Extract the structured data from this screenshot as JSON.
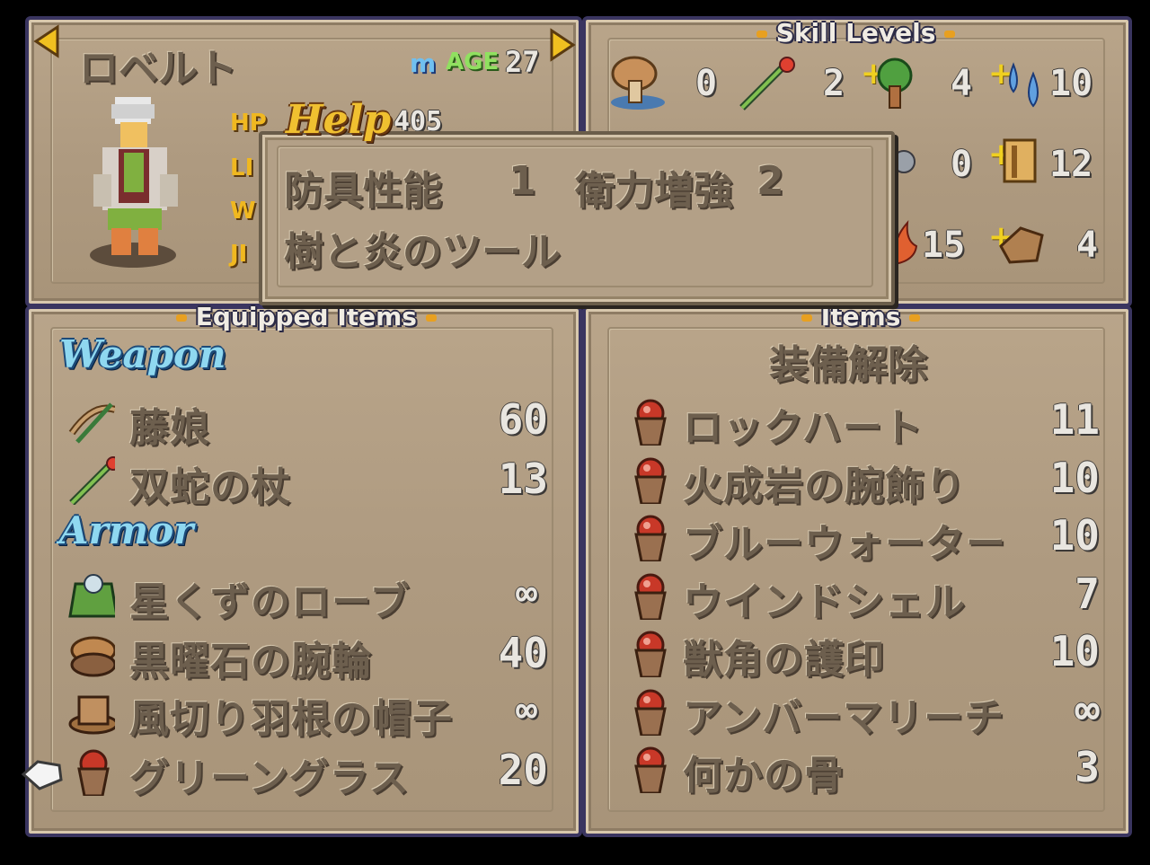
{
  "character": {
    "name": "ロベルト",
    "age_label": "AGE",
    "age": "27",
    "stats": {
      "hp_label": "HP",
      "hp_value": "405",
      "l_label": "LI",
      "w_label": "W",
      "j_label": "JI"
    }
  },
  "help_tooltip": {
    "title": "Help",
    "line1_left": "防具性能",
    "line1_left_value": "1",
    "line1_right": "衛力増強",
    "line1_right_value": "2",
    "line2": "樹と炎のツール"
  },
  "skill_levels": {
    "title": "Skill Levels",
    "row1": [
      "0",
      "2",
      "4",
      "10"
    ],
    "row2": [
      "0",
      "12"
    ],
    "row3": [
      "15",
      "4"
    ]
  },
  "equipped": {
    "title": "Equipped Items",
    "weapon_label": "Weapon",
    "armor_label": "Armor",
    "weapons": [
      {
        "name": "藤娘",
        "value": "60",
        "icon": "crossbow-icon"
      },
      {
        "name": "双蛇の杖",
        "value": "13",
        "icon": "staff-icon"
      }
    ],
    "armor": [
      {
        "name": "星くずのローブ",
        "value": "∞",
        "icon": "robe-icon"
      },
      {
        "name": "黒曜石の腕輪",
        "value": "40",
        "icon": "bracelet-icon"
      },
      {
        "name": "風切り羽根の帽子",
        "value": "∞",
        "icon": "hat-icon"
      },
      {
        "name": "グリーングラス",
        "value": "20",
        "icon": "acorn-icon"
      }
    ]
  },
  "items": {
    "title": "Items",
    "unequip_label": "装備解除",
    "list": [
      {
        "name": "ロックハート",
        "value": "11"
      },
      {
        "name": "火成岩の腕飾り",
        "value": "10"
      },
      {
        "name": "ブルーウォーター",
        "value": "10"
      },
      {
        "name": "ウインドシェル",
        "value": "7"
      },
      {
        "name": "獣角の護印",
        "value": "10"
      },
      {
        "name": "アンバーマリーチ",
        "value": "∞"
      },
      {
        "name": "何かの骨",
        "value": "3"
      }
    ]
  },
  "colors": {
    "accent_gold": "#f0b820",
    "frame": "#3a3560",
    "category_blue": "#8fd8f0"
  }
}
